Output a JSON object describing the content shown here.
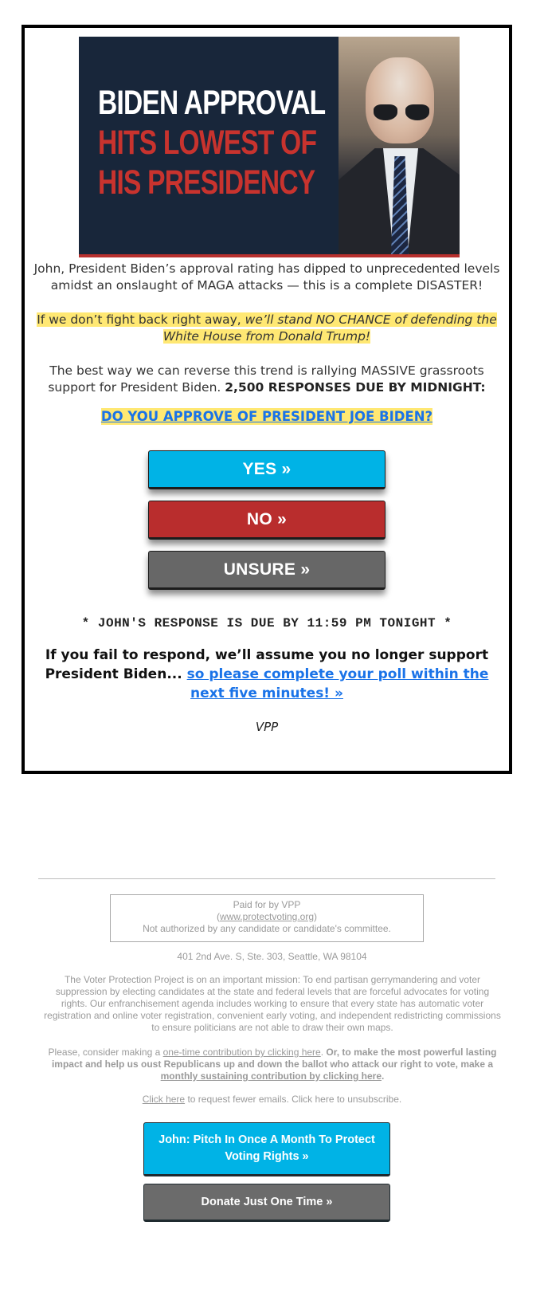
{
  "hero": {
    "line1": "BIDEN APPROVAL",
    "line2": "HITS LOWEST OF",
    "line3": "HIS PRESIDENCY",
    "photo_alt": "Joe Biden wearing aviator sunglasses"
  },
  "intro": "John, President Biden’s approval rating has dipped to unprecedented levels amidst an onslaught of MAGA attacks — this is a complete DISASTER!",
  "highlight": {
    "plain": "If we don’t fight back right away, ",
    "italic": "we’ll stand NO CHANCE of defending the White House from Donald Trump!"
  },
  "rally": {
    "plain": "The best way we can reverse this trend is rallying MASSIVE grassroots support for President Biden. ",
    "bold": "2,500 RESPONSES DUE BY MIDNIGHT:"
  },
  "question": "DO YOU APPROVE OF PRESIDENT JOE BIDEN?",
  "poll_buttons": {
    "yes": "YES »",
    "no": "NO »",
    "unsure": "UNSURE »"
  },
  "deadline": "* JOHN'S RESPONSE IS DUE BY 11:59 PM TONIGHT *",
  "warning": {
    "bold": "If you fail to respond, we’ll assume you no longer support President Biden... ",
    "link": "so please complete your poll within the next five minutes! »"
  },
  "signature": "VPP",
  "footer": {
    "paid_for": "Paid for by VPP",
    "url_open": "(",
    "url": "www.protectvoting.org",
    "url_close": ")",
    "disclaimer": "Not authorized by any candidate or candidate's committee.",
    "address": "401 2nd Ave. S, Ste. 303, Seattle, WA 98104",
    "mission": "The Voter Protection Project is on an important mission: To end partisan gerrymandering and voter suppression by electing candidates at the state and federal levels that are forceful advocates for voting rights. Our enfranchisement agenda includes working to ensure that every state has automatic voter registration and online voter registration, convenient early voting, and independent redistricting commissions to ensure politicians are not able to draw their own maps.",
    "contrib_prefix": "Please, consider making a ",
    "contrib_once_link": "one-time contribution by clicking here",
    "contrib_period": ". ",
    "contrib_bold": "Or, to make the most powerful lasting impact and help us oust Republicans up and down the ballot who attack our right to vote, make a ",
    "contrib_monthly_link": "monthly sustaining contribution by clicking here",
    "contrib_end": ".",
    "fewer_link": "Click here",
    "fewer_rest": " to request fewer emails. Click here to unsubscribe."
  },
  "donate_buttons": {
    "monthly": "John: Pitch In Once A Month To Protect Voting Rights »",
    "once": "Donate Just One Time »"
  },
  "colors": {
    "yes": "#00b3e6",
    "no": "#b92d2d",
    "unsure": "#676767",
    "highlight": "#ffe873",
    "link": "#1a73e8",
    "hero_bg": "#18263a",
    "hero_red": "#c8332e"
  }
}
